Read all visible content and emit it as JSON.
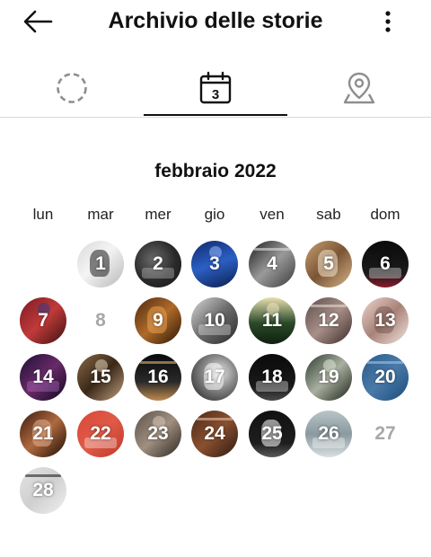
{
  "header": {
    "title": "Archivio delle storie"
  },
  "tabs": [
    {
      "name": "stories-circle-icon",
      "active": false
    },
    {
      "name": "calendar-icon",
      "badge": "3",
      "active": true
    },
    {
      "name": "location-pin-icon",
      "active": false
    }
  ],
  "calendar": {
    "month_label": "febbraio 2022",
    "weekdays": [
      "lun",
      "mar",
      "mer",
      "gio",
      "ven",
      "sab",
      "dom"
    ],
    "days": [
      {
        "label": "1",
        "has_story": true,
        "bg": "linear-gradient(135deg,#d9d9d9 0%,#f4f4f4 45%,#b8b8b8 100%)",
        "deco": "#1b1b1b"
      },
      {
        "label": "2",
        "has_story": true,
        "bg": "radial-gradient(circle at 40% 40%,#6a6a6a 0%,#2a2a2a 55%,#151515 100%)",
        "deco": "#cfcfcf"
      },
      {
        "label": "3",
        "has_story": true,
        "bg": "linear-gradient(160deg,#0f2a6b 0%,#2c5fc4 50%,#0b1d4a 100%)",
        "deco": "#9fc2ff"
      },
      {
        "label": "4",
        "has_story": true,
        "bg": "linear-gradient(135deg,#1a1a1a 0%,#9a9a9a 50%,#3a3a3a 100%)",
        "deco": "#e0e0e0"
      },
      {
        "label": "5",
        "has_story": true,
        "bg": "linear-gradient(135deg,#c8a070 0%,#7a5535 50%,#d7b58a 100%)",
        "deco": "#f4e4cc"
      },
      {
        "label": "6",
        "has_story": true,
        "bg": "linear-gradient(180deg,#0a0a0a 0%,#1b1b1b 70%,#8b1a2b 100%)",
        "deco": "#ffffff"
      },
      {
        "label": "7",
        "has_story": true,
        "bg": "linear-gradient(135deg,#7a1a22 0%,#c13a3a 50%,#3a1010 100%)",
        "deco": "#2a3a8a"
      },
      {
        "label": "8",
        "has_story": false
      },
      {
        "label": "9",
        "has_story": true,
        "bg": "linear-gradient(135deg,#4a2a10 0%,#b06a2a 50%,#2a1505 100%)",
        "deco": "#e8a050"
      },
      {
        "label": "10",
        "has_story": true,
        "bg": "linear-gradient(135deg,#d8d8d8 0%,#6a6a6a 50%,#2a2a2a 100%)",
        "deco": "#f0f0f0"
      },
      {
        "label": "11",
        "has_story": true,
        "bg": "linear-gradient(180deg,#e8e0b0 0%,#2a4a2a 55%,#10200f 100%)",
        "deco": "#f5e9c0"
      },
      {
        "label": "12",
        "has_story": true,
        "bg": "linear-gradient(135deg,#5a4a48 0%,#a89088 50%,#3a2a28 100%)",
        "deco": "#e8d8d0"
      },
      {
        "label": "13",
        "has_story": true,
        "bg": "linear-gradient(135deg,#ecd6d0 0%,#a88278 50%,#f2e6e0 100%)",
        "deco": "#7a5a50"
      },
      {
        "label": "14",
        "has_story": true,
        "bg": "linear-gradient(135deg,#1a1030 0%,#6a2a6a 50%,#0f0820 100%)",
        "deco": "#c07ad0"
      },
      {
        "label": "15",
        "has_story": true,
        "bg": "linear-gradient(135deg,#8a6a48 0%,#3a2818 50%,#c0a080 100%)",
        "deco": "#f0e0c8"
      },
      {
        "label": "16",
        "has_story": true,
        "bg": "linear-gradient(180deg,#0a0a0a 0%,#2a2a2a 60%,#c08a50 100%)",
        "deco": "#e0b070"
      },
      {
        "label": "17",
        "has_story": true,
        "bg": "radial-gradient(circle at 60% 40%,#e8e8e8 0%,#8a8a8a 40%,#1a1a1a 100%)",
        "deco": "#ffffff"
      },
      {
        "label": "18",
        "has_story": true,
        "bg": "linear-gradient(180deg,#0a0a0a 0%,#1a1a1a 70%,#4a4a4a 100%)",
        "deco": "#ffffff"
      },
      {
        "label": "19",
        "has_story": true,
        "bg": "linear-gradient(135deg,#2a3a30 0%,#aab0a0 50%,#1a2018 100%)",
        "deco": "#e8f0e0"
      },
      {
        "label": "20",
        "has_story": true,
        "bg": "linear-gradient(135deg,#2a5a8a 0%,#4a7aa8 50%,#1a4a7a 100%)",
        "deco": "#9ec4e8"
      },
      {
        "label": "21",
        "has_story": true,
        "bg": "linear-gradient(135deg,#3a1a10 0%,#b06a40 50%,#1a0a05 100%)",
        "deco": "#e8b090"
      },
      {
        "label": "22",
        "has_story": true,
        "bg": "linear-gradient(135deg,#d84838 0%,#e05a48 50%,#c03828 100%)",
        "deco": "#ffffff"
      },
      {
        "label": "23",
        "has_story": true,
        "bg": "linear-gradient(135deg,#5a5048 0%,#a09080 50%,#2a2420 100%)",
        "deco": "#e0d0c0"
      },
      {
        "label": "24",
        "has_story": true,
        "bg": "linear-gradient(135deg,#4a2818 0%,#8a5030 50%,#2a1810 100%)",
        "deco": "#e8c0a0"
      },
      {
        "label": "25",
        "has_story": true,
        "bg": "linear-gradient(180deg,#111111 0%,#1e1e1e 70%,#5a5a5a 100%)",
        "deco": "#ffffff"
      },
      {
        "label": "26",
        "has_story": true,
        "bg": "linear-gradient(180deg,#b8c4c8 0%,#8a9a9e 50%,#d8e0e2 100%)",
        "deco": "#ffffff"
      },
      {
        "label": "27",
        "has_story": false
      },
      {
        "label": "28",
        "has_story": true,
        "bg": "linear-gradient(135deg,#e4e4e4 0%,#cfcfcf 50%,#f0f0f0 100%)",
        "deco": "#222222"
      }
    ]
  }
}
